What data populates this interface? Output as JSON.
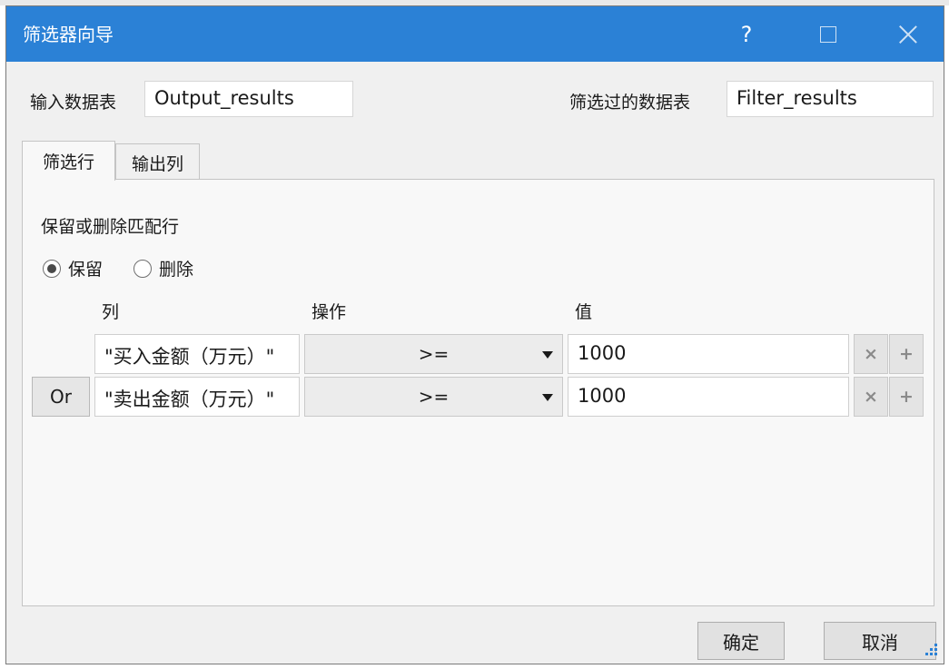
{
  "window": {
    "title": "筛选器向导",
    "help_glyph": "?"
  },
  "header": {
    "input_table_label": "输入数据表",
    "input_table_value": "Output_results",
    "filtered_table_label": "筛选过的数据表",
    "filtered_table_value": "Filter_results"
  },
  "tabs": [
    {
      "label": "筛选行",
      "active": true
    },
    {
      "label": "输出列",
      "active": false
    }
  ],
  "filter_rows": {
    "section_label": "保留或删除匹配行",
    "mode_options": [
      {
        "label": "保留",
        "selected": true
      },
      {
        "label": "删除",
        "selected": false
      }
    ],
    "column_headers": {
      "column": "列",
      "operation": "操作",
      "value": "值"
    },
    "conditions": [
      {
        "connector": "",
        "column": "\"买入金额（万元）\"",
        "operator": ">=",
        "value": "1000"
      },
      {
        "connector": "Or",
        "column": "\"卖出金额（万元）\"",
        "operator": ">=",
        "value": "1000"
      }
    ],
    "remove_glyph": "×",
    "add_glyph": "+"
  },
  "footer": {
    "ok_label": "确定",
    "cancel_label": "取消"
  },
  "colors": {
    "titlebar": "#2b81d6",
    "dialog_bg": "#f0f0f0",
    "panel_bg": "#f8f8f8"
  },
  "icons": [
    "help-icon",
    "maximize-icon",
    "close-icon",
    "dropdown-arrow-icon",
    "remove-condition-icon",
    "add-condition-icon",
    "resize-grip-icon"
  ]
}
